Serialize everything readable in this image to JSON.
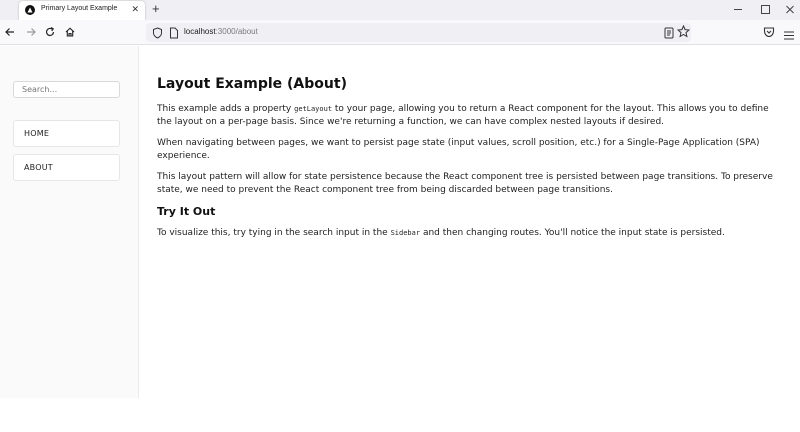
{
  "browser": {
    "tab": {
      "title": "Primary Layout Example",
      "close": "✕"
    },
    "new_tab": "+",
    "url": {
      "host": "localhost",
      "rest": ":3000/about"
    }
  },
  "sidebar": {
    "search": {
      "placeholder": "Search...",
      "value": ""
    },
    "links": [
      {
        "label": "HOME"
      },
      {
        "label": "ABOUT"
      }
    ]
  },
  "main": {
    "heading": "Layout Example (About)",
    "p1": {
      "before": "This example adds a property ",
      "code": "getLayout",
      "after": " to your page, allowing you to return a React component for the layout. This allows you to define the layout on a per-page basis. Since we're returning a function, we can have complex nested layouts if desired."
    },
    "p2": "When navigating between pages, we want to persist page state (input values, scroll position, etc.) for a Single-Page Application (SPA) experience.",
    "p3": "This layout pattern will allow for state persistence because the React component tree is persisted between page transitions. To preserve state, we need to prevent the React component tree from being discarded between page transitions.",
    "subheading": "Try It Out",
    "p4": {
      "before": "To visualize this, try tying in the search input in the ",
      "code": "Sidebar",
      "after": " and then changing routes. You'll notice the input state is persisted."
    }
  }
}
